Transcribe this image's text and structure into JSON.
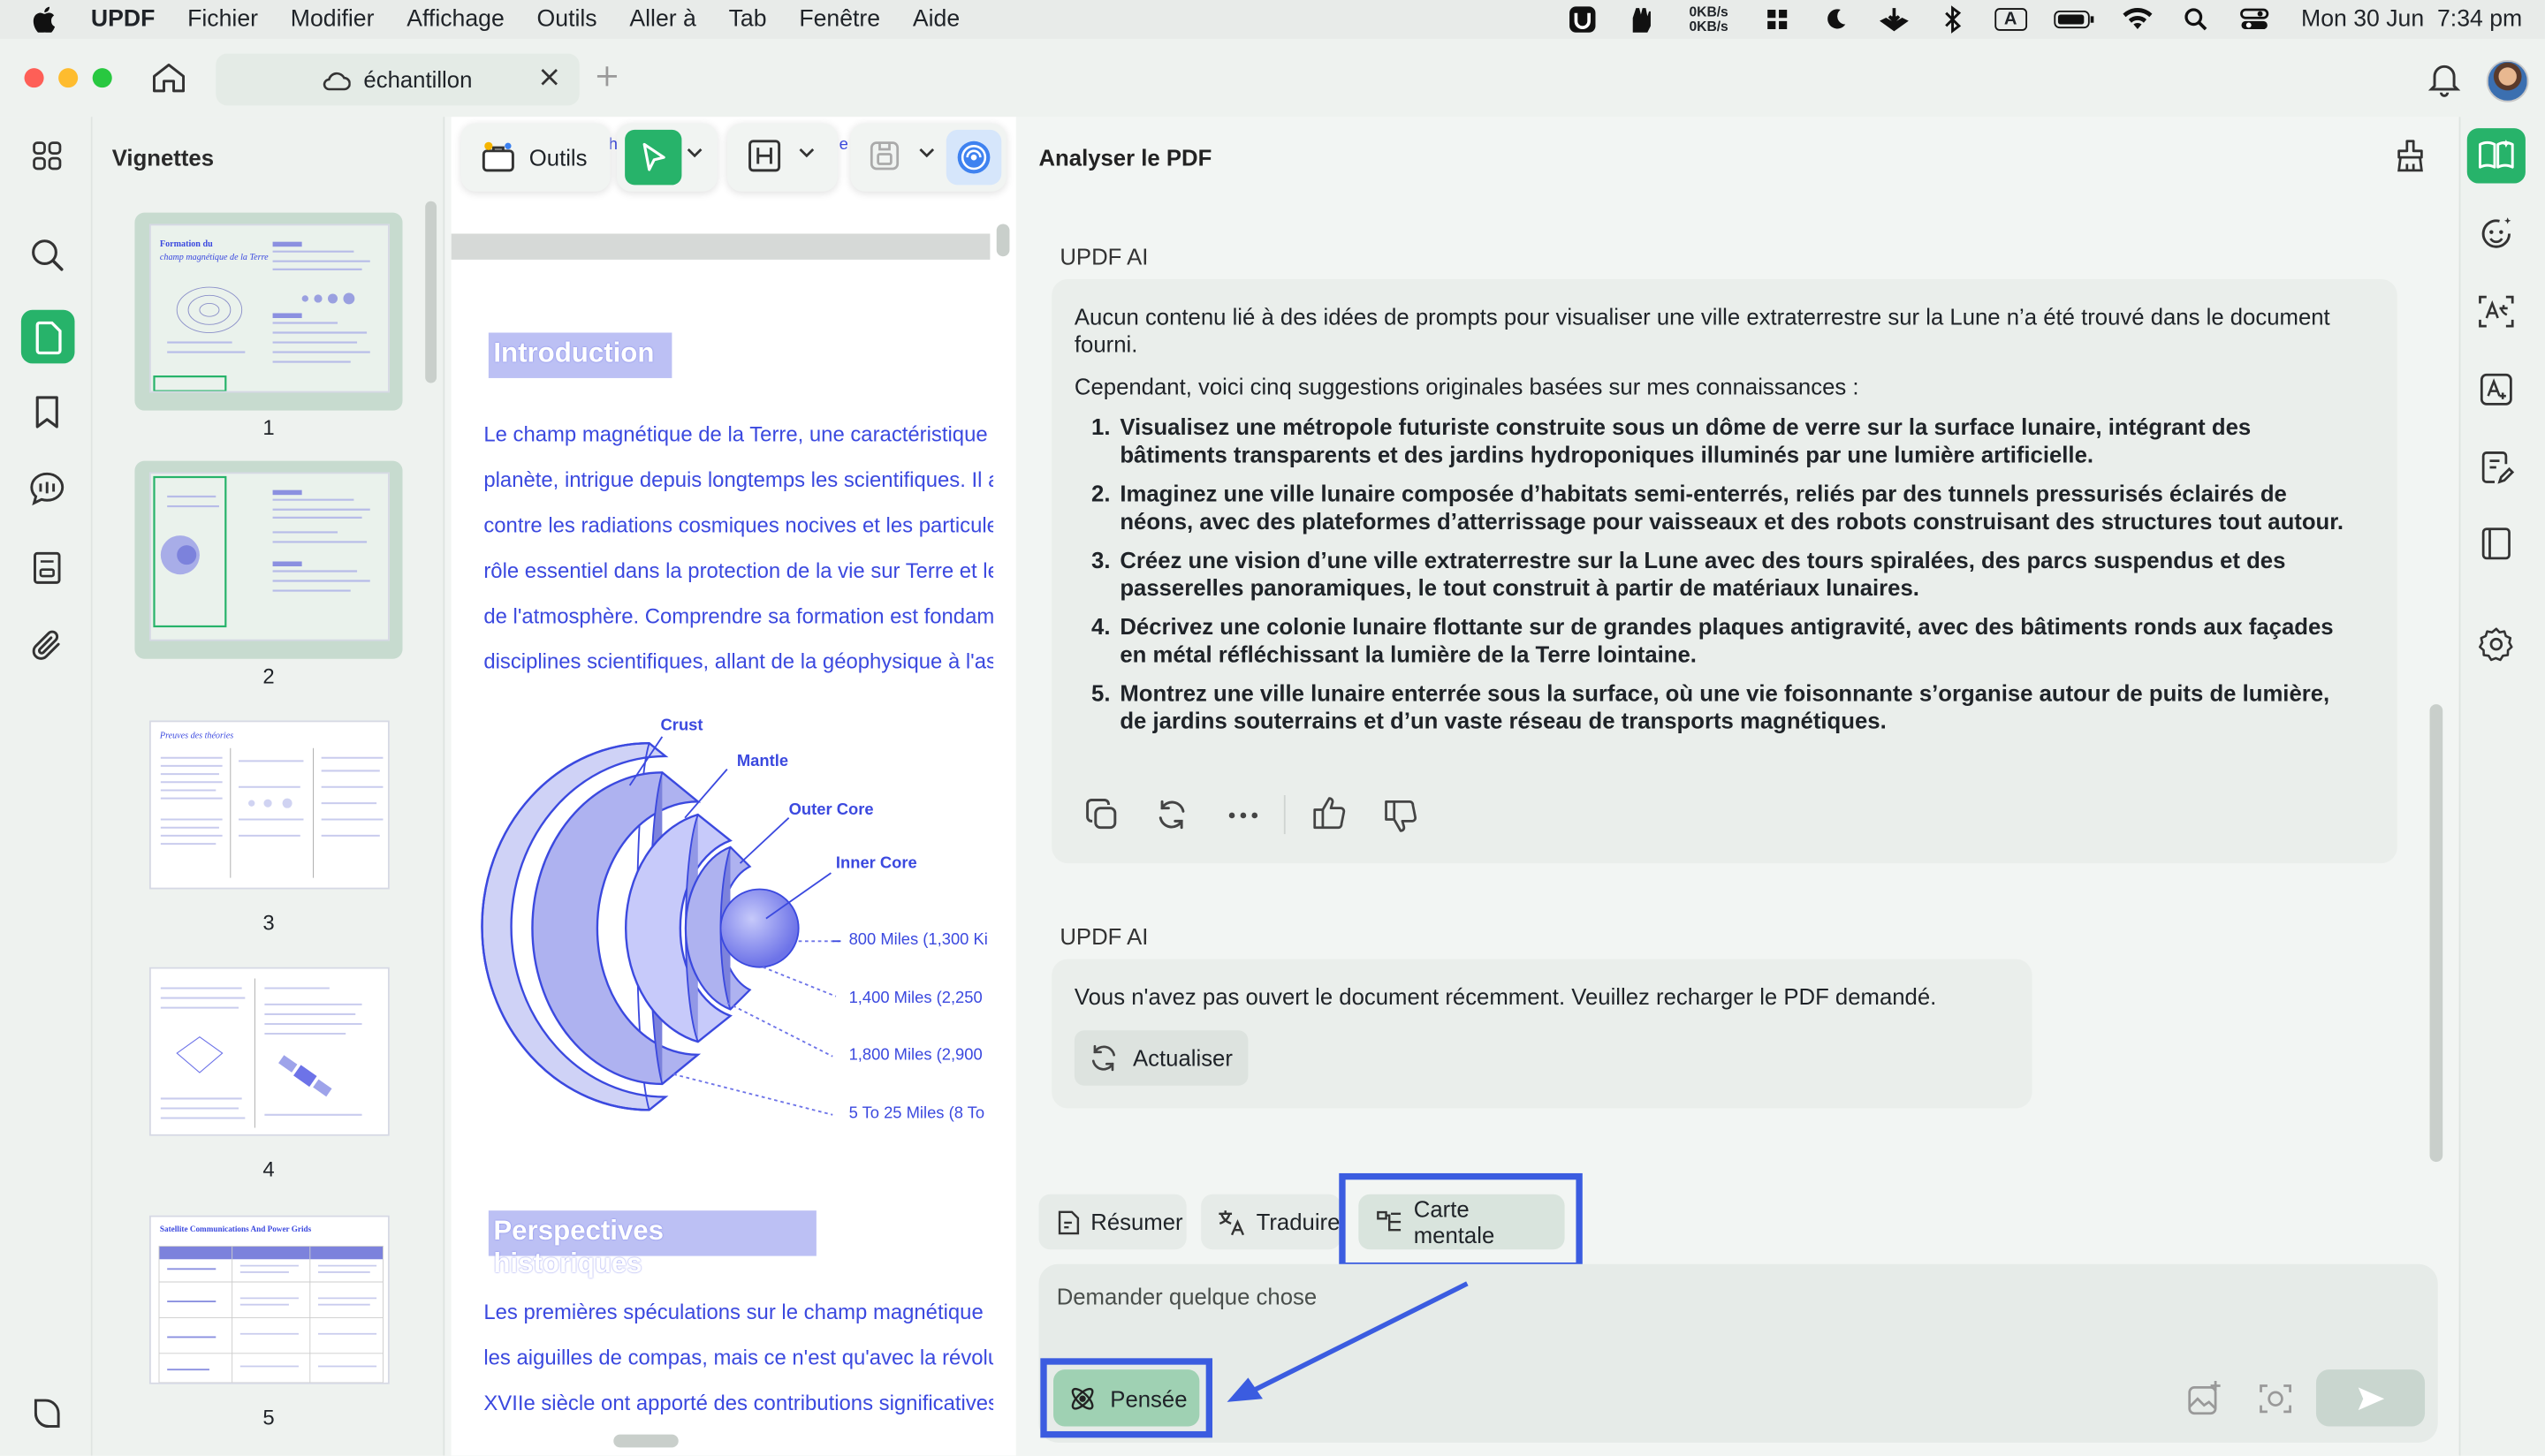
{
  "menubar": {
    "app": "UPDF",
    "items": [
      "Fichier",
      "Modifier",
      "Affichage",
      "Outils",
      "Aller à",
      "Tab",
      "Fenêtre",
      "Aide"
    ],
    "net_up": "0KB/s",
    "net_down": "0KB/s",
    "input_badge": "A",
    "clock": "Mon 30 Jun  7:34 pm"
  },
  "tab": {
    "title": "échantillon"
  },
  "thumbnails": {
    "title": "Vignettes",
    "pages": [
      "1",
      "2",
      "3",
      "4",
      "5"
    ],
    "p1_title": "Formation du",
    "p1_subtitle": "champ magnétique de la Terre",
    "p3_title": "Preuves des théories",
    "p5_title": "Satellite Communications And Power Grids"
  },
  "toolbar": {
    "tools_label": "Outils"
  },
  "document": {
    "intro_heading": "Introduction",
    "intro_lines": [
      "Le champ magnétique de la Terre, une caractéristique",
      "planète, intrigue depuis longtemps les scientifiques. Il a",
      "contre les radiations cosmiques nocives et les particule",
      "rôle essentiel dans la protection de la vie sur Terre et le",
      "de l'atmosphère. Comprendre sa formation est fondam",
      "disciplines scientifiques, allant de la géophysique à l'as"
    ],
    "diagram": {
      "crust": "Crust",
      "mantle": "Mantle",
      "outer_core": "Outer Core",
      "inner_core": "Inner Core",
      "d1": "800 Miles (1,300 Ki",
      "d2": "1,400 Miles (2,250",
      "d3": "1,800 Miles (2,900",
      "d4": "5 To 25 Miles (8 To"
    },
    "hist_heading": "Perspectives historiques",
    "hist_lines": [
      "Les premières spéculations sur le champ magnétique",
      "les aiguilles de compas, mais ce n'est qu'avec la révolu",
      "XVIIe siècle ont apporté des contributions significatives"
    ]
  },
  "ai": {
    "header": "Analyser le PDF",
    "sender": "UPDF AI",
    "msg1": {
      "p1": "Aucun contenu lié à des idées de prompts pour visualiser une ville extraterrestre sur la Lune n’a été trouvé dans le document fourni.",
      "p2": "Cependant, voici cinq suggestions originales basées sur mes connaissances :",
      "items": [
        "Visualisez une métropole futuriste construite sous un dôme de verre sur la surface lunaire, intégrant des bâtiments transparents et des jardins hydroponiques illuminés par une lumière artificielle.",
        "Imaginez une ville lunaire composée d’habitats semi-enterrés, reliés par des tunnels pressurisés éclairés de néons, avec des plateformes d’atterrissage pour vaisseaux et des robots construisant des structures tout autour.",
        "Créez une vision d’une ville extraterrestre sur la Lune avec des tours spiralées, des parcs suspendus et des passerelles panoramiques, le tout construit à partir de matériaux lunaires.",
        "Décrivez une colonie lunaire flottante sur de grandes plaques antigravité, avec des bâtiments ronds aux façades en métal réfléchissant la lumière de la Terre lointaine.",
        "Montrez une ville lunaire enterrée sous la surface, où une vie foisonnante s’organise autour de puits de lumière, de jardins souterrains et d’un vaste réseau de transports magnétiques."
      ]
    },
    "msg2": {
      "text": "Vous n'avez pas ouvert le document récemment. Veuillez recharger le PDF demandé.",
      "refresh": "Actualiser"
    },
    "chips": {
      "summarize": "Résumer",
      "translate": "Traduire",
      "mindmap": "Carte mentale"
    },
    "input_placeholder": "Demander quelque chose",
    "think": "Pensée"
  },
  "colors": {
    "accent": "#27b36a",
    "highlight": "#3b5ce0",
    "doc_blue": "#3b49df"
  }
}
